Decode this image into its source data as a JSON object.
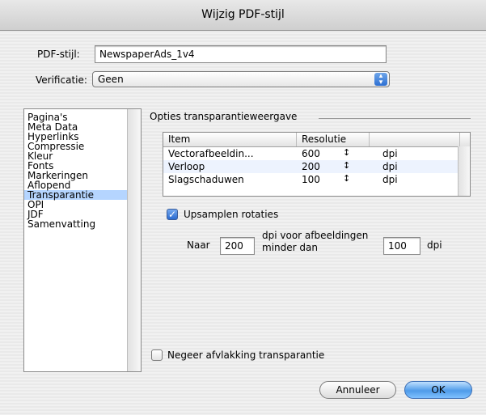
{
  "window": {
    "title": "Wijzig PDF-stijl"
  },
  "pdf_style": {
    "label": "PDF-stijl:",
    "value": "NewspaperAds_1v4"
  },
  "verification": {
    "label": "Verificatie:",
    "value": "Geen"
  },
  "sidebar": {
    "items": [
      {
        "label": "Pagina's"
      },
      {
        "label": "Meta Data"
      },
      {
        "label": "Hyperlinks"
      },
      {
        "label": "Compressie"
      },
      {
        "label": "Kleur"
      },
      {
        "label": "Fonts"
      },
      {
        "label": "Markeringen"
      },
      {
        "label": "Aflopend"
      },
      {
        "label": "Transparantie"
      },
      {
        "label": "OPI"
      },
      {
        "label": "JDF"
      },
      {
        "label": "Samenvatting"
      }
    ],
    "selected": "Transparantie"
  },
  "panel": {
    "group_title": "Opties transparantieweergave",
    "table": {
      "headers": [
        "Item",
        "Resolutie",
        ""
      ],
      "rows": [
        {
          "item": "Vectorafbeeldin...",
          "resolution": "600",
          "unit": "dpi"
        },
        {
          "item": "Verloop",
          "resolution": "200",
          "unit": "dpi"
        },
        {
          "item": "Slagschaduwen",
          "resolution": "100",
          "unit": "dpi"
        }
      ],
      "stepper_glyph": "↕"
    },
    "upsample": {
      "label": "Upsamplen rotaties",
      "checked": true,
      "to_label": "Naar",
      "to_value": "200",
      "mid_label_line1": "dpi voor afbeeldingen",
      "mid_label_line2": "minder dan",
      "threshold_value": "100",
      "unit": "dpi"
    },
    "ignore_flattening": {
      "label": "Negeer afvlakking transparantie",
      "checked": false
    }
  },
  "buttons": {
    "cancel": "Annuleer",
    "ok": "OK"
  },
  "colors": {
    "selection": "#b5d5ff",
    "accent": "#2a6bd0"
  }
}
